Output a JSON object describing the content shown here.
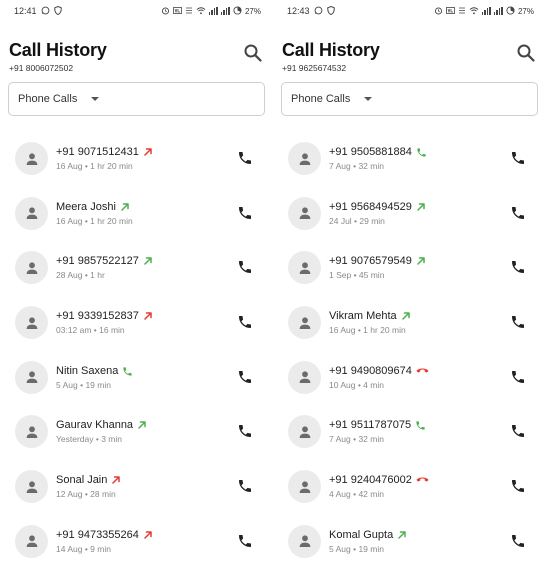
{
  "colors": {
    "outgoing": "#4caf50",
    "missed": "#e53935",
    "rejected": "#e53935",
    "incoming": "#4caf50",
    "avatar_bg": "#ebebeb",
    "avatar_fg": "#6b6b6b"
  },
  "screens": [
    {
      "status": {
        "time": "12:41",
        "battery": "27%"
      },
      "title": "Call History",
      "subtitle": "+91 8006072502",
      "filter": "Phone Calls",
      "calls": [
        {
          "name": "+91 9071512431",
          "meta": "16 Aug • 1 hr 20 min",
          "type": "missed"
        },
        {
          "name": "Meera Joshi",
          "meta": "16 Aug • 1 hr 20 min",
          "type": "outgoing"
        },
        {
          "name": "+91 9857522127",
          "meta": "28 Aug • 1 hr",
          "type": "outgoing"
        },
        {
          "name": "+91 9339152837",
          "meta": "03:12 am • 16 min",
          "type": "missed"
        },
        {
          "name": "Nitin Saxena",
          "meta": "5 Aug • 19 min",
          "type": "incoming"
        },
        {
          "name": "Gaurav Khanna",
          "meta": "Yesterday • 3 min",
          "type": "outgoing"
        },
        {
          "name": "Sonal Jain",
          "meta": "12 Aug • 28 min",
          "type": "missed"
        },
        {
          "name": "+91 9473355264",
          "meta": "14 Aug • 9 min",
          "type": "missed"
        }
      ]
    },
    {
      "status": {
        "time": "12:43",
        "battery": "27%"
      },
      "title": "Call History",
      "subtitle": "+91 9625674532",
      "filter": "Phone Calls",
      "calls": [
        {
          "name": "+91 9505881884",
          "meta": "7 Aug • 32 min",
          "type": "incoming"
        },
        {
          "name": "+91 9568494529",
          "meta": "24 Jul • 29 min",
          "type": "outgoing"
        },
        {
          "name": "+91 9076579549",
          "meta": "1 Sep • 45 min",
          "type": "outgoing"
        },
        {
          "name": "Vikram Mehta",
          "meta": "16 Aug • 1 hr 20 min",
          "type": "outgoing"
        },
        {
          "name": "+91 9490809674",
          "meta": "10 Aug • 4 min",
          "type": "rejected"
        },
        {
          "name": "+91 9511787075",
          "meta": "7 Aug • 32 min",
          "type": "incoming"
        },
        {
          "name": "+91 9240476002",
          "meta": "4 Aug • 42 min",
          "type": "rejected"
        },
        {
          "name": "Komal Gupta",
          "meta": "5 Aug • 19 min",
          "type": "outgoing"
        }
      ]
    }
  ]
}
